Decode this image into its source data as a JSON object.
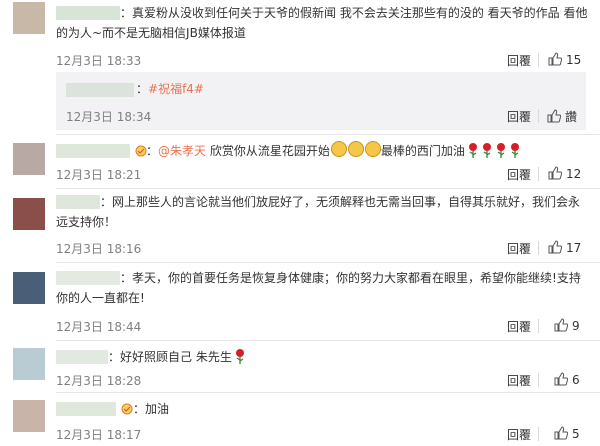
{
  "comments": [
    {
      "text": "：真爱粉从没收到任何关于天爷的假新闻 我不会去关注那些有的没的 看天爷的作品 看他的为人~而不是无脑相信JB媒体报道",
      "time": "12月3日 18:33",
      "reply": "回覆",
      "likes": "15",
      "avatar_color": "#c7b8a8",
      "nested": {
        "colon": "：",
        "text": "#祝福f4#",
        "time": "12月3日 18:34",
        "reply": "回覆",
        "like_label": "讚"
      }
    },
    {
      "mention": "@朱孝天",
      "text": " 欣赏你从流星花园开始",
      "text2": "最棒的西门加油",
      "time": "12月3日 18:21",
      "reply": "回覆",
      "likes": "12",
      "avatar_color": "#b8a9a4"
    },
    {
      "text": "：网上那些人的言论就当他们放屁好了，无须解释也无需当回事，自得其乐就好，我们会永远支持你！",
      "time": "12月3日 18:16",
      "reply": "回覆",
      "likes": "17",
      "avatar_color": "#8a4f4a"
    },
    {
      "text": "：孝天，你的首要任务是恢复身体健康；你的努力大家都看在眼里，希望你能继续!支持你的人一直都在!",
      "time": "12月3日 18:44",
      "reply": "回覆",
      "likes": "9",
      "avatar_color": "#4a5e78"
    },
    {
      "text": "：好好照顾自己 朱先生",
      "time": "12月3日 18:28",
      "reply": "回覆",
      "likes": "6",
      "avatar_color": "#b9ccd4"
    },
    {
      "text": "：加油",
      "time": "12月3日 18:17",
      "reply": "回覆",
      "likes": "5",
      "avatar_color": "#c9b4aa"
    }
  ]
}
